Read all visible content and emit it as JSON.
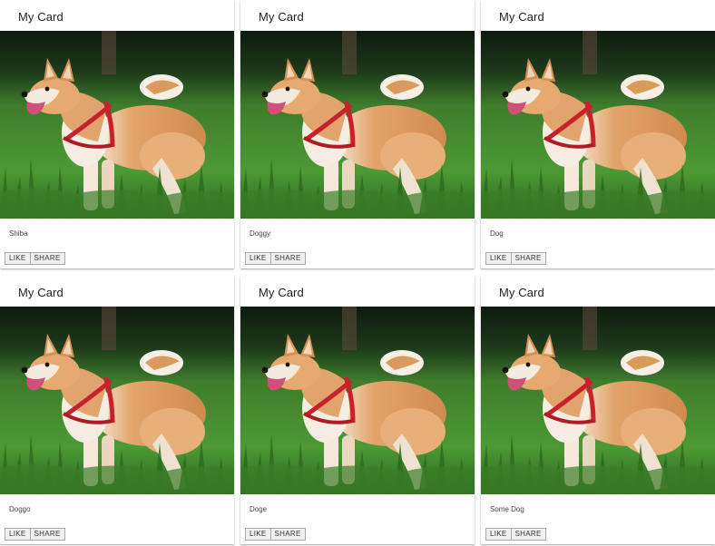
{
  "cards": [
    {
      "title": "My Card",
      "text": "Shiba",
      "like_label": "LIKE",
      "share_label": "SHARE"
    },
    {
      "title": "My Card",
      "text": "Doggy",
      "like_label": "LIKE",
      "share_label": "SHARE"
    },
    {
      "title": "My Card",
      "text": "Dog",
      "like_label": "LIKE",
      "share_label": "SHARE"
    },
    {
      "title": "My Card",
      "text": "Doggo",
      "like_label": "LIKE",
      "share_label": "SHARE"
    },
    {
      "title": "My Card",
      "text": "Doge",
      "like_label": "LIKE",
      "share_label": "SHARE"
    },
    {
      "title": "My Card",
      "text": "Some Dog",
      "like_label": "LIKE",
      "share_label": "SHARE"
    }
  ],
  "colors": {
    "grass": "#3f8a2c",
    "fur": "#d9955a",
    "harness": "#c8202c"
  }
}
